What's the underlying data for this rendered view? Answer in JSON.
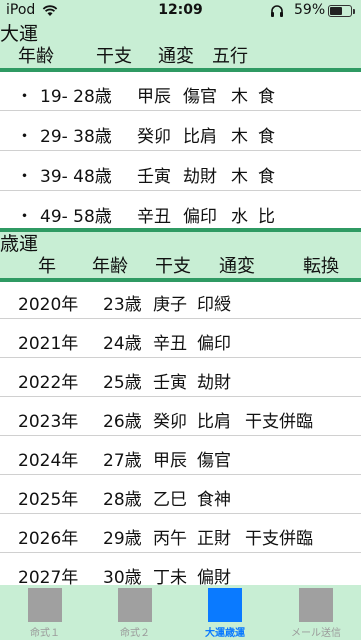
{
  "status": {
    "carrier": "iPod",
    "time": "12:09",
    "battery": "59%",
    "battery_level": 0.59
  },
  "daiun": {
    "title": "大運",
    "columns": [
      "年齢",
      "干支",
      "通変",
      "五行"
    ],
    "rows": [
      {
        "bullet": "・",
        "age": "19- 28歳",
        "kanshi": "甲辰",
        "tsuhen": "傷官",
        "gogyo1": "木",
        "gogyo2": "食"
      },
      {
        "bullet": "・",
        "age": "29- 38歳",
        "kanshi": "癸卯",
        "tsuhen": "比肩",
        "gogyo1": "木",
        "gogyo2": "食"
      },
      {
        "bullet": "・",
        "age": "39- 48歳",
        "kanshi": "壬寅",
        "tsuhen": "劫財",
        "gogyo1": "木",
        "gogyo2": "食"
      },
      {
        "bullet": "・",
        "age": "49- 58歳",
        "kanshi": "辛丑",
        "tsuhen": "偏印",
        "gogyo1": "水",
        "gogyo2": "比"
      }
    ]
  },
  "saiun": {
    "title": "歳運",
    "columns": [
      "年",
      "年齢",
      "干支",
      "通変",
      "転換"
    ],
    "rows": [
      {
        "year": "2020年",
        "age": "23歳",
        "kanshi": "庚子",
        "tsuhen": "印綬",
        "tenkan": ""
      },
      {
        "year": "2021年",
        "age": "24歳",
        "kanshi": "辛丑",
        "tsuhen": "偏印",
        "tenkan": ""
      },
      {
        "year": "2022年",
        "age": "25歳",
        "kanshi": "壬寅",
        "tsuhen": "劫財",
        "tenkan": ""
      },
      {
        "year": "2023年",
        "age": "26歳",
        "kanshi": "癸卯",
        "tsuhen": "比肩",
        "tenkan": "干支併臨"
      },
      {
        "year": "2024年",
        "age": "27歳",
        "kanshi": "甲辰",
        "tsuhen": "傷官",
        "tenkan": ""
      },
      {
        "year": "2025年",
        "age": "28歳",
        "kanshi": "乙巳",
        "tsuhen": "食神",
        "tenkan": ""
      },
      {
        "year": "2026年",
        "age": "29歳",
        "kanshi": "丙午",
        "tsuhen": "正財",
        "tenkan": "干支併臨"
      },
      {
        "year": "2027年",
        "age": "30歳",
        "kanshi": "丁未",
        "tsuhen": "偏財",
        "tenkan": ""
      }
    ]
  },
  "tabs": [
    {
      "label": "命式１",
      "active": false
    },
    {
      "label": "命式２",
      "active": false
    },
    {
      "label": "大運歳運",
      "active": true
    },
    {
      "label": "メール送信",
      "active": false
    }
  ],
  "colors": {
    "header_bg": "#c8eed4",
    "rule": "#2f9a63",
    "accent": "#0a7aff",
    "inactive_icon": "#a0a0a0"
  }
}
